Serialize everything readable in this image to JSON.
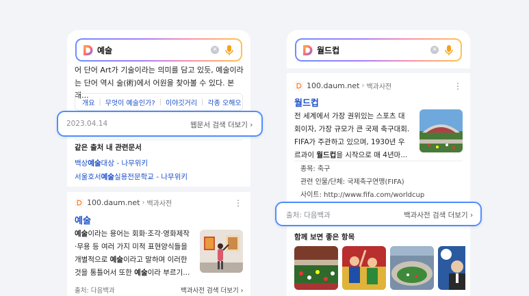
{
  "left": {
    "search": {
      "query": "예술"
    },
    "snippet": {
      "line1": "어 단어 Art가 기술이라는 의미를 담고 있듯, 예술이라",
      "line2": "는 단어 역시 술(術)에서 어원을 찾아볼 수 있다. 본래..."
    },
    "subtabs": [
      "개요",
      "무엇이 예술인가?",
      "이야깃거리",
      "각종 오해오"
    ],
    "date_row": {
      "date": "2023.04.14",
      "more": "웹문서 검색 더보기"
    },
    "related": {
      "heading": "같은 출처 내 관련문서",
      "links": [
        {
          "pre": "백상",
          "em": "예술",
          "post": "대상 - 나무위키"
        },
        {
          "pre": "서울호서",
          "em": "예술",
          "post": "실용전문학교 - 나무위키"
        }
      ]
    },
    "result": {
      "source": "100.daum.net",
      "category": "백과사전",
      "title": "예술",
      "lines": [
        [
          "",
          "예술",
          "이라는 용어는 회화·조각·영화제작"
        ],
        [
          "",
          "",
          "·무용 등 여러 가지 미적 표현양식들을"
        ],
        [
          "",
          "",
          "개별적으로 "
        ],
        [
          "",
          "",
          "것을 통틀어서 또한 "
        ]
      ],
      "line1": {
        "b": "예술",
        "t": "이라는 용어는 회화·조각·영화제작"
      },
      "line2": {
        "t": "·무용 등 여러 가지 미적 표현양식들을"
      },
      "line3": {
        "t1": "개별적으로 ",
        "b": "예술",
        "t2": "이라고 말하며 이러한"
      },
      "line4": {
        "t1": "것을 통틀어서 또한 ",
        "b": "예술",
        "t2": "이라 부르기..."
      },
      "footer_source": "출처: 다음백과",
      "footer_more": "백과사전 검색 더보기"
    }
  },
  "right": {
    "search": {
      "query": "월드컵"
    },
    "result": {
      "source": "100.daum.net",
      "category": "백과사전",
      "title": "월드컵",
      "line1": "전 세계에서 가장 권위있는 스포츠 대",
      "line2": "회이자, 가장 규모가 큰 국제 축구대회.",
      "line3": "FIFA가 주관하고 있으며, 1930년 우",
      "line4": {
        "t1": "르과이 ",
        "b": "월드컵",
        "t2": "을 시작으로 매 4년마..."
      },
      "info": [
        {
          "label": "종목:",
          "value": "축구"
        },
        {
          "label": "관련 인물/단체:",
          "value": "국제축구연맹(FIFA)"
        },
        {
          "label": "사이트:",
          "value": "http://www.fifa.com/worldcup"
        }
      ],
      "footer_source": "출처: 다음백과",
      "footer_more": "백과사전 검색 더보기"
    },
    "related": {
      "heading": "함께 보면 좋은 항목"
    }
  },
  "colors": {
    "accent_link": "#1b4fc9",
    "highlight_border": "#4f8dff",
    "background": "#f3f4f7"
  }
}
